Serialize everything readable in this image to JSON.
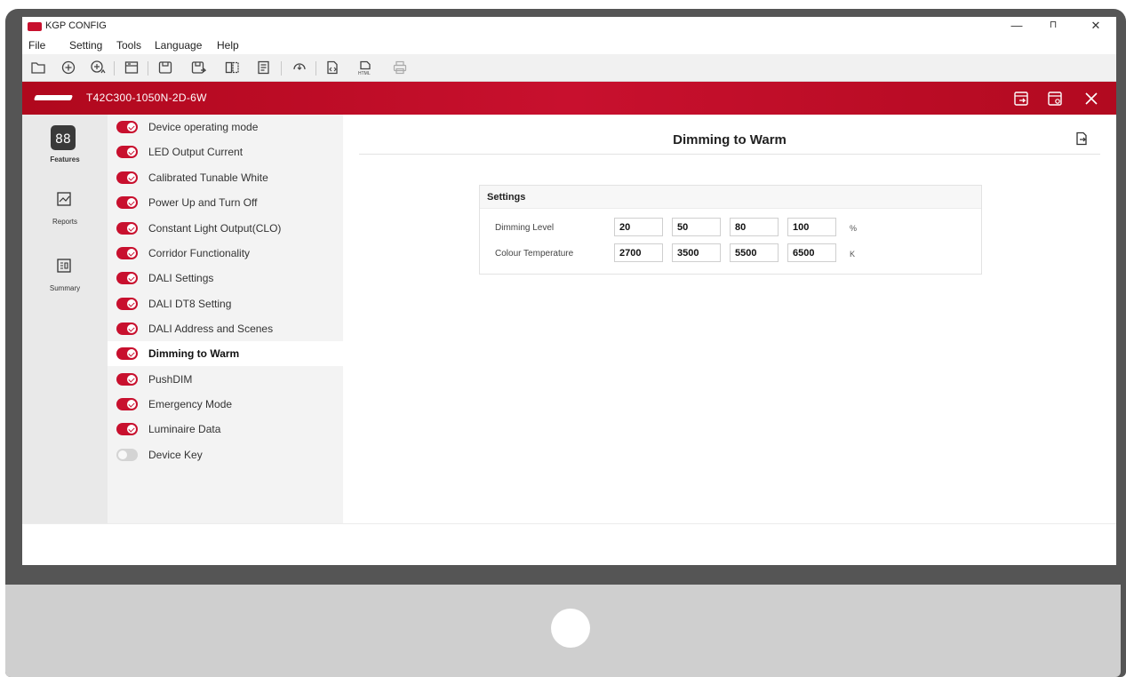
{
  "app": {
    "title": "KGP CONFIG"
  },
  "window_controls": {
    "minimize": "—",
    "maximize": "⊓",
    "close": "✕"
  },
  "menu": [
    "File",
    "Setting",
    "Tools",
    "Language",
    "Help"
  ],
  "toolbar_icons": [
    "folder-open-icon",
    "add-circle-icon",
    "add-up-icon",
    "save-list-icon",
    "save-icon",
    "save-as-icon",
    "compare-icon",
    "document-icon",
    "read-device-icon",
    "export-file-icon",
    "html-export-icon",
    "print-icon"
  ],
  "device": {
    "name": "T42C300-1050N-2D-6W"
  },
  "rail": {
    "items": [
      {
        "label": "Features",
        "icon": "features-grid-icon"
      },
      {
        "label": "Reports",
        "icon": "chart-icon"
      },
      {
        "label": "Summary",
        "icon": "summary-icon"
      }
    ]
  },
  "features": [
    {
      "label": "Device operating mode",
      "on": true
    },
    {
      "label": "LED Output Current",
      "on": true
    },
    {
      "label": "Calibrated Tunable White",
      "on": true
    },
    {
      "label": "Power Up and Turn Off",
      "on": true
    },
    {
      "label": "Constant Light Output(CLO)",
      "on": true
    },
    {
      "label": "Corridor Functionality",
      "on": true
    },
    {
      "label": "DALI Settings",
      "on": true
    },
    {
      "label": "DALI DT8 Setting",
      "on": true
    },
    {
      "label": "DALI Address and Scenes",
      "on": true
    },
    {
      "label": "Dimming to Warm",
      "on": true,
      "active": true
    },
    {
      "label": "PushDIM",
      "on": true
    },
    {
      "label": "Emergency Mode",
      "on": true
    },
    {
      "label": "Luminaire Data",
      "on": true
    },
    {
      "label": "Device Key",
      "on": false
    }
  ],
  "main": {
    "title": "Dimming to Warm",
    "settings": {
      "title": "Settings",
      "dimming_level": {
        "label": "Dimming Level",
        "values": [
          "20",
          "50",
          "80",
          "100"
        ],
        "unit": "%"
      },
      "colour_temperature": {
        "label": "Colour Temperature",
        "values": [
          "2700",
          "3500",
          "5500",
          "6500"
        ],
        "unit": "K"
      }
    }
  },
  "colors": {
    "brand_red": "#c8102e",
    "rail_bg": "#e9e9e9",
    "list_bg": "#f3f3f3"
  }
}
